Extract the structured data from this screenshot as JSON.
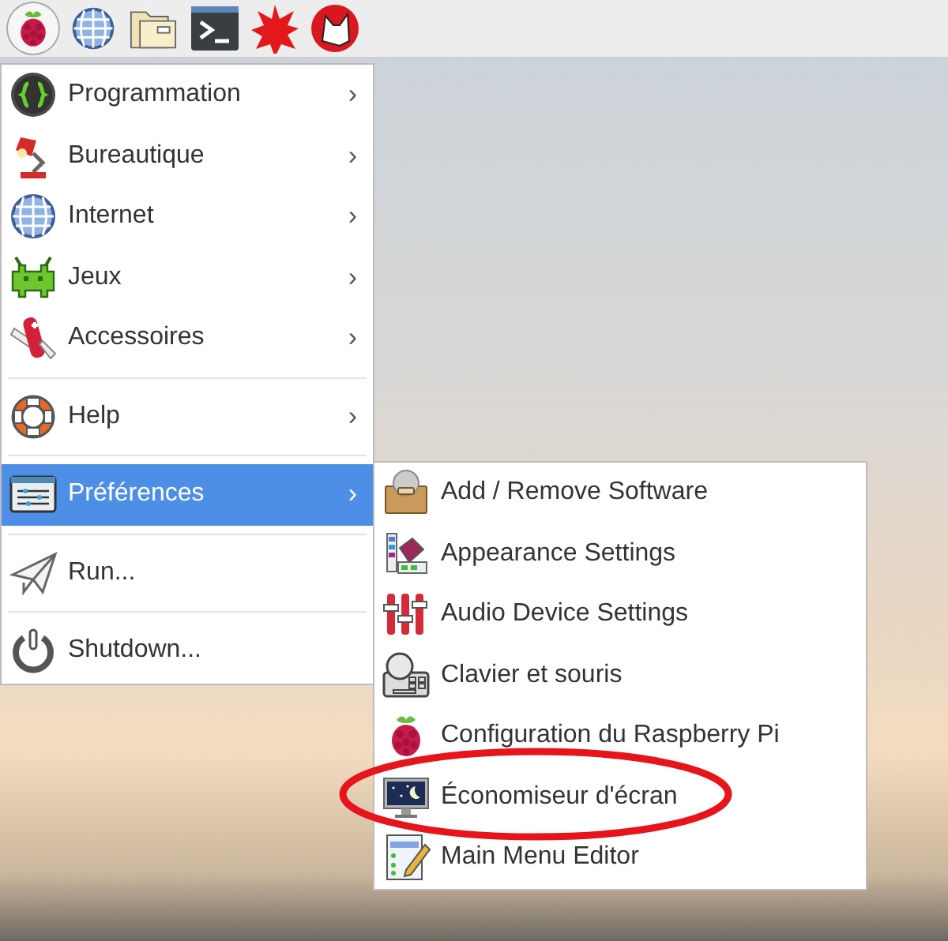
{
  "taskbar": {
    "menu_button_pressed": true
  },
  "main_menu": {
    "items": [
      {
        "kind": "item",
        "label": "Programmation",
        "arrow": "›",
        "selected": false
      },
      {
        "kind": "item",
        "label": "Bureautique",
        "arrow": "›",
        "selected": false
      },
      {
        "kind": "item",
        "label": "Internet",
        "arrow": "›",
        "selected": false
      },
      {
        "kind": "item",
        "label": "Jeux",
        "arrow": "›",
        "selected": false
      },
      {
        "kind": "item",
        "label": "Accessoires",
        "arrow": "›",
        "selected": false
      },
      {
        "kind": "separator"
      },
      {
        "kind": "item",
        "label": "Help",
        "arrow": "›",
        "selected": false
      },
      {
        "kind": "separator"
      },
      {
        "kind": "item",
        "label": "Préférences",
        "arrow": "›",
        "selected": true
      },
      {
        "kind": "separator"
      },
      {
        "kind": "item",
        "label": "Run...",
        "selected": false
      },
      {
        "kind": "separator"
      },
      {
        "kind": "item",
        "label": "Shutdown...",
        "selected": false
      }
    ]
  },
  "submenu": {
    "items": [
      {
        "label": "Add / Remove Software",
        "circled": false
      },
      {
        "label": "Appearance Settings",
        "circled": false
      },
      {
        "label": "Audio Device Settings",
        "circled": false
      },
      {
        "label": "Clavier et souris",
        "circled": false
      },
      {
        "label": "Configuration du Raspberry Pi",
        "circled": false
      },
      {
        "label": "Économiseur d'écran",
        "circled": true
      },
      {
        "label": "Main Menu Editor",
        "circled": false
      }
    ]
  }
}
